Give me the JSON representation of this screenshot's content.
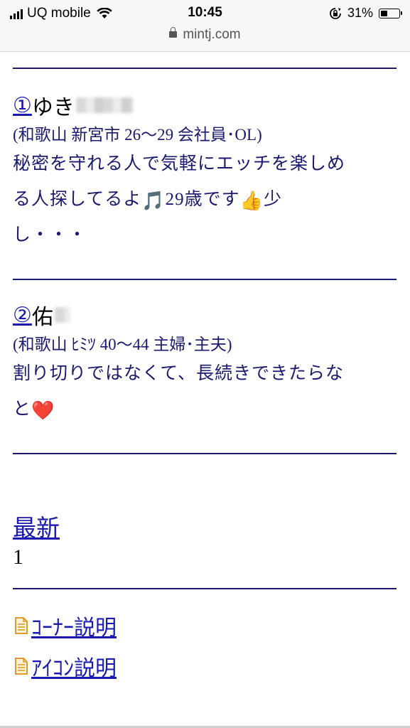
{
  "status_bar": {
    "carrier": "UQ mobile",
    "time": "10:45",
    "battery": "31%",
    "battery_level": 0.31
  },
  "url_bar": {
    "domain": "mintj.com"
  },
  "entries": [
    {
      "number": "①",
      "name": "ゆき",
      "meta": "(和歌山 新宮市 26〜29 会社員･OL)",
      "message_lines": [
        "秘密を守れる人で気軽にエッチを楽しめ",
        "る人探してるよ",
        "29歳です",
        "少",
        "し・・・"
      ],
      "emoji_note": "🎵",
      "emoji_thumb": "👍"
    },
    {
      "number": "②",
      "name": "佑",
      "meta": "(和歌山 ﾋﾐﾂ 40〜44 主婦･主夫)",
      "message_lines": [
        "割り切りではなくて、長続きできたらな",
        "と"
      ],
      "emoji_heart": "❤️"
    }
  ],
  "latest": {
    "label": "最新",
    "page": "1"
  },
  "links": [
    {
      "label": "ｺｰﾅｰ説明",
      "icon": "document-icon"
    },
    {
      "label": "ｱｲｺﾝ説明",
      "icon": "document-icon"
    }
  ]
}
